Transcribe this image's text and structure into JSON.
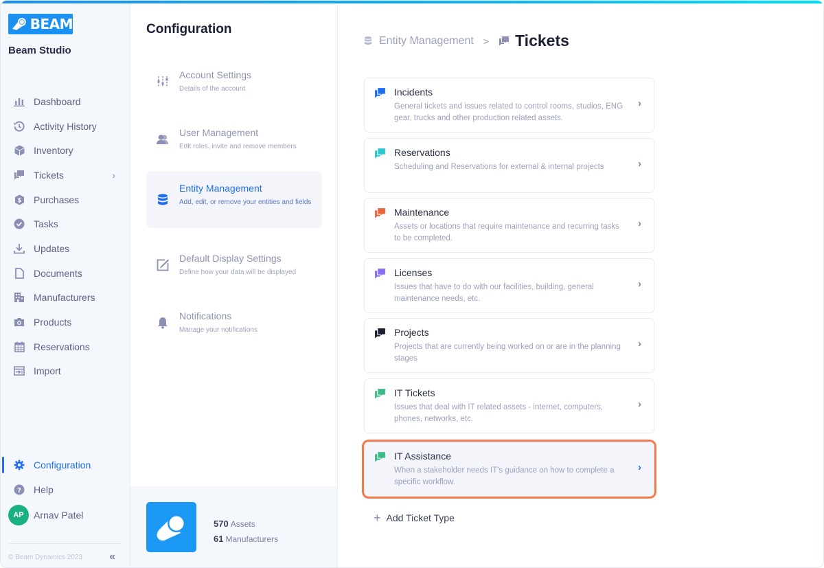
{
  "app": {
    "logo_text": "BEAM",
    "studio_name": "Beam Studio"
  },
  "sidebar": {
    "items": [
      {
        "label": "Dashboard",
        "icon": "bar-chart-icon"
      },
      {
        "label": "Activity History",
        "icon": "history-icon"
      },
      {
        "label": "Inventory",
        "icon": "cube-icon"
      },
      {
        "label": "Tickets",
        "icon": "chat-bubbles-icon",
        "has_submenu": true
      },
      {
        "label": "Purchases",
        "icon": "dollar-badge-icon"
      },
      {
        "label": "Tasks",
        "icon": "check-circle-icon"
      },
      {
        "label": "Updates",
        "icon": "download-icon"
      },
      {
        "label": "Documents",
        "icon": "document-icon"
      },
      {
        "label": "Manufacturers",
        "icon": "building-icon"
      },
      {
        "label": "Products",
        "icon": "camera-icon"
      },
      {
        "label": "Reservations",
        "icon": "calendar-icon"
      },
      {
        "label": "Import",
        "icon": "import-icon"
      }
    ],
    "bottom_items": [
      {
        "label": "Configuration",
        "icon": "gear-icon",
        "active": true
      },
      {
        "label": "Help",
        "icon": "question-icon"
      }
    ],
    "user": {
      "initials": "AP",
      "name": "Arnav Patel",
      "avatar_color": "#19b184"
    },
    "copyright": "© Beam Dynamics 2023",
    "collapse_icon": "«"
  },
  "config": {
    "title": "Configuration",
    "items": [
      {
        "title": "Account Settings",
        "desc": "Details of the account",
        "icon": "sliders-icon"
      },
      {
        "title": "User Management",
        "desc": "Edit roles, invite and remove members",
        "icon": "users-icon"
      },
      {
        "title": "Entity Management",
        "desc": "Add, edit, or remove your entities and fields",
        "icon": "database-icon",
        "active": true
      },
      {
        "title": "Default Display Settings",
        "desc": "Define how your data will be displayed",
        "icon": "edit-square-icon"
      },
      {
        "title": "Notifications",
        "desc": "Manage your notifications",
        "icon": "bell-icon"
      }
    ],
    "stats": {
      "assets_count": "570",
      "assets_label": "Assets",
      "manufacturers_count": "61",
      "manufacturers_label": "Manufacturers"
    }
  },
  "main": {
    "breadcrumb": {
      "parent": "Entity Management",
      "separator": ">",
      "current": "Tickets"
    },
    "tickets": [
      {
        "name": "Incidents",
        "desc": "General tickets and issues related to control rooms, studios, ENG gear, trucks and other production related assets.",
        "color": "#1f6ff0"
      },
      {
        "name": "Reservations",
        "desc": "Scheduling and Reservations for external & internal projects",
        "color": "#2cc7cf"
      },
      {
        "name": "Maintenance",
        "desc": "Assets or locations that require maintenance and recurring tasks to be completed.",
        "color": "#e8673d"
      },
      {
        "name": "Licenses",
        "desc": "Issues that have to do with our facilities, building, general maintenance needs, etc.",
        "color": "#8a6ef0"
      },
      {
        "name": "Projects",
        "desc": "Projects that are currently being worked on or are in the planning stages",
        "color": "#1c1f33"
      },
      {
        "name": "IT Tickets",
        "desc": "Issues that deal with IT related assets - internet, computers, phones, networks, etc.",
        "color": "#3cba8a"
      },
      {
        "name": "IT Assistance",
        "desc": "When a stakeholder needs IT's guidance on how to complete a specific workflow.",
        "color": "#3cba8a",
        "selected": true
      }
    ],
    "add_label": "Add Ticket Type",
    "highlight_color": "#f47b47"
  }
}
